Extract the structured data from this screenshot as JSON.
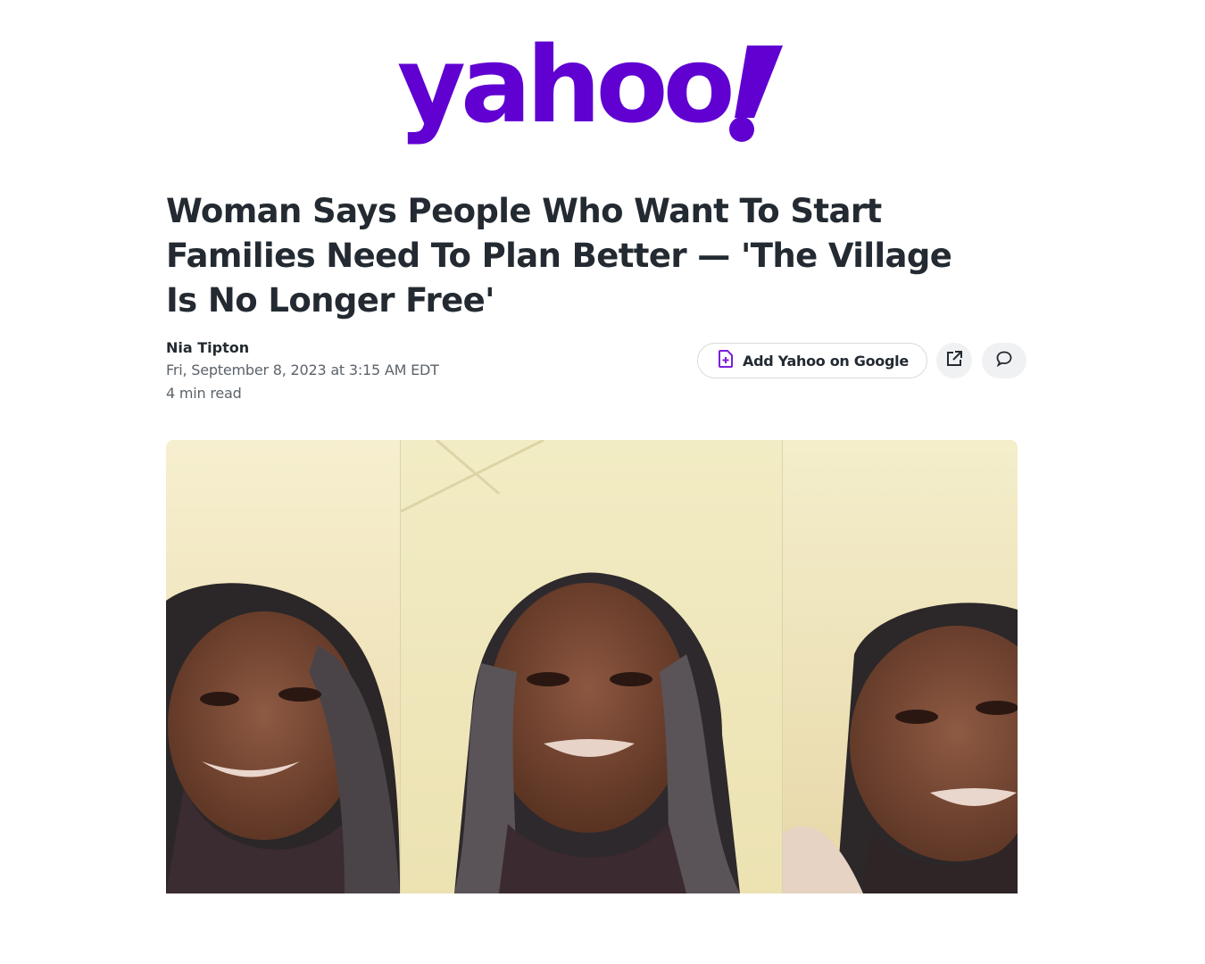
{
  "brand": {
    "name": "yahoo!",
    "color": "#6001d2"
  },
  "article": {
    "title": "Woman Says People Who Want To Start Families Need To Plan Better — 'The Village Is No Longer Free'",
    "author": "Nia Tipton",
    "date": "Fri, September 8, 2023 at 3:15 AM EDT",
    "read_time": "4 min read"
  },
  "actions": {
    "add_google_label": "Add Yahoo on Google",
    "add_google_icon": "document-plus-icon",
    "share_icon": "external-share-icon",
    "comment_icon": "speech-bubble-icon"
  },
  "hero": {
    "panels": 3,
    "subject": "woman-speaking-to-camera"
  }
}
